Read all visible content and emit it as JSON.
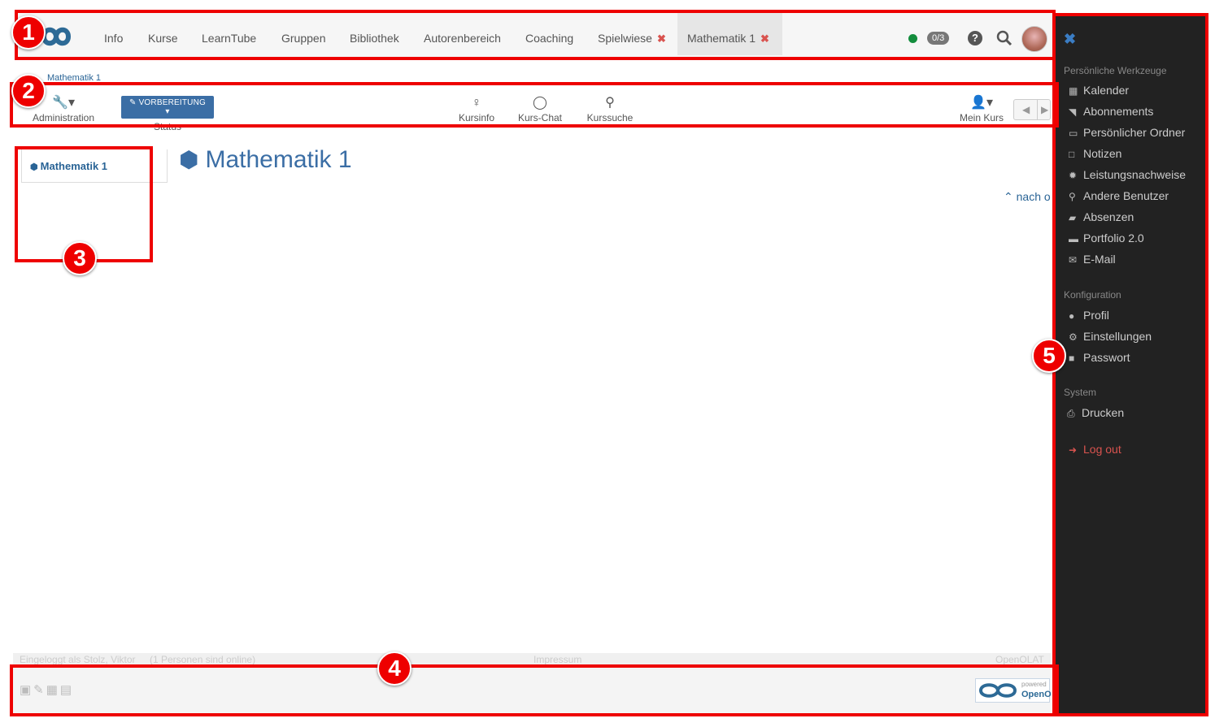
{
  "topnav": {
    "tabs": [
      "Info",
      "Kurse",
      "LearnTube",
      "Gruppen",
      "Bibliothek",
      "Autorenbereich",
      "Coaching",
      "Spielwiese",
      "Mathematik 1"
    ],
    "chat_count": "0/3"
  },
  "breadcrumb": "Mathematik 1",
  "toolbar": {
    "administration": "Administration",
    "status_button": "VORBEREITUNG",
    "status_label": "Status",
    "kursinfo": "Kursinfo",
    "kurschat": "Kurs-Chat",
    "kurssuche": "Kurssuche",
    "mein_kurs": "Mein Kurs"
  },
  "menu": {
    "item": "Mathematik 1"
  },
  "main": {
    "title": "Mathematik 1",
    "toc_link": "nach o"
  },
  "footer": {
    "logged_in": "Eingeloggt als Stolz, Viktor",
    "online": "(1 Personen sind online)",
    "impressum": "Impressum",
    "version": "OpenOLAT",
    "powered": "powered",
    "brand": "OpenO"
  },
  "offcanvas": {
    "section_personal": "Persönliche Werkzeuge",
    "personal": [
      "Kalender",
      "Abonnements",
      "Persönlicher Ordner",
      "Notizen",
      "Leistungsnachweise",
      "Andere Benutzer",
      "Absenzen",
      "Portfolio 2.0",
      "E-Mail"
    ],
    "section_config": "Konfiguration",
    "config": [
      "Profil",
      "Einstellungen",
      "Passwort"
    ],
    "section_system": "System",
    "system": [
      "Drucken"
    ],
    "logout": "Log out"
  },
  "annotations": [
    "1",
    "2",
    "3",
    "4",
    "5"
  ],
  "colors": {
    "accent": "#3b6ea5",
    "annotation": "#e00000",
    "offcanvas_bg": "#222222",
    "close": "#d9534f"
  }
}
